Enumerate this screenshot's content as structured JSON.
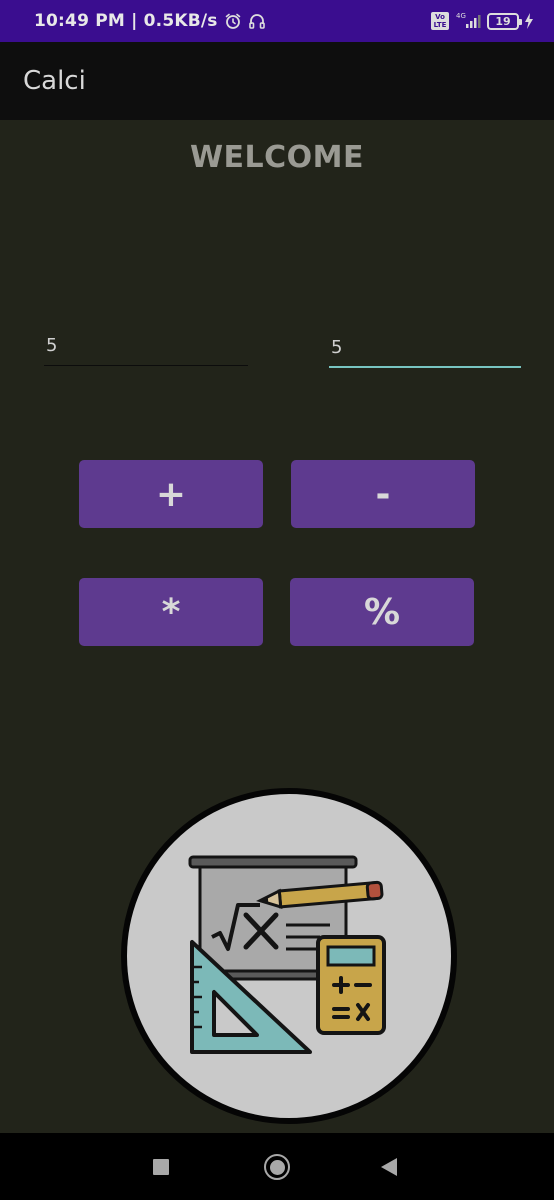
{
  "status_bar": {
    "time": "10:49 PM | 0.5KB/s",
    "alarm_icon": "alarm-clock-icon",
    "headphones_icon": "headphones-icon",
    "volte_label": "Vo LTE",
    "network_label": "4G",
    "battery_level": "19",
    "charging_icon": "lightning-icon"
  },
  "app_bar": {
    "title": "Calci"
  },
  "main": {
    "heading": "WELCOME",
    "input_1": {
      "value": "5"
    },
    "input_2": {
      "value": "5"
    },
    "buttons": {
      "add": "+",
      "subtract": "-",
      "multiply": "*",
      "modulo": "%"
    },
    "logo_icon": "math-calculator-icon"
  },
  "nav_bar": {
    "recent_icon": "square-icon",
    "home_icon": "circle-icon",
    "back_icon": "triangle-back-icon"
  },
  "colors": {
    "status_bar": "#3a0d8f",
    "app_bar": "#0e0e0e",
    "background": "#22241a",
    "button": "#5e3a8f",
    "focused_underline": "#78c5c1"
  }
}
